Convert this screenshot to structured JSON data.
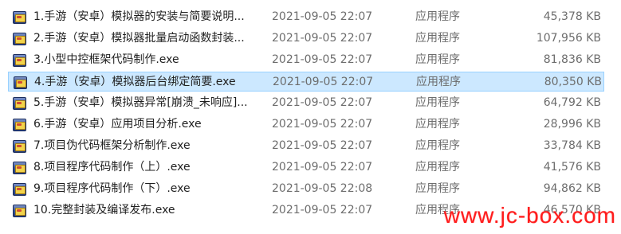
{
  "files": [
    {
      "name": "1.手游（安卓）模拟器的安装与简要说明...",
      "modified": "2021-09-05 22:07",
      "type": "应用程序",
      "size": "45,378 KB",
      "icon": "exe-icon",
      "selected": false
    },
    {
      "name": "2.手游（安卓）模拟器批量启动函数封装...",
      "modified": "2021-09-05 22:07",
      "type": "应用程序",
      "size": "107,956 KB",
      "icon": "exe-icon",
      "selected": false
    },
    {
      "name": "3.小型中控框架代码制作.exe",
      "modified": "2021-09-05 22:07",
      "type": "应用程序",
      "size": "81,836 KB",
      "icon": "exe-icon",
      "selected": false
    },
    {
      "name": "4.手游（安卓）模拟器后台绑定简要.exe",
      "modified": "2021-09-05 22:07",
      "type": "应用程序",
      "size": "80,350 KB",
      "icon": "exe-icon",
      "selected": true
    },
    {
      "name": "5.手游（安卓）模拟器异常[崩溃_未响应]...",
      "modified": "2021-09-05 22:07",
      "type": "应用程序",
      "size": "64,792 KB",
      "icon": "exe-icon",
      "selected": false
    },
    {
      "name": "6.手游（安卓）应用项目分析.exe",
      "modified": "2021-09-05 22:07",
      "type": "应用程序",
      "size": "28,996 KB",
      "icon": "exe-icon",
      "selected": false
    },
    {
      "name": "7.项目伪代码框架分析制作.exe",
      "modified": "2021-09-05 22:07",
      "type": "应用程序",
      "size": "33,784 KB",
      "icon": "exe-icon",
      "selected": false
    },
    {
      "name": "8.项目程序代码制作（上）.exe",
      "modified": "2021-09-05 22:07",
      "type": "应用程序",
      "size": "41,576 KB",
      "icon": "exe-icon",
      "selected": false
    },
    {
      "name": "9.项目程序代码制作（下）.exe",
      "modified": "2021-09-05 22:08",
      "type": "应用程序",
      "size": "94,862 KB",
      "icon": "exe-icon",
      "selected": false
    },
    {
      "name": "10.完整封装及编译发布.exe",
      "modified": "2021-09-05 22:07",
      "type": "应用程序",
      "size": "46,570 KB",
      "icon": "exe-icon",
      "selected": false
    }
  ],
  "watermark": "www.jc-box.com",
  "colors": {
    "selection_background": "#cce8ff",
    "selection_border": "#99d1ff",
    "secondary_text": "#6d6d6d",
    "watermark": "#ff1d1d"
  }
}
